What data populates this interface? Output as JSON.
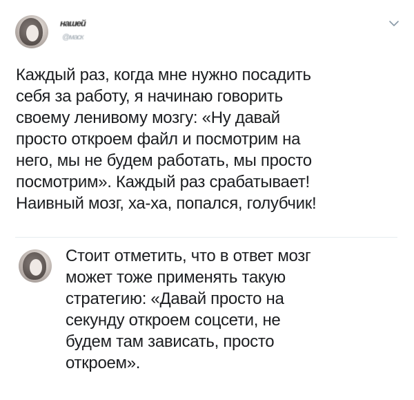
{
  "post": {
    "author": {
      "name": "нашей",
      "handle": "@маск"
    },
    "text": "Каждый раз, когда мне нужно посадить\nсебя за работу, я начинаю говорить\nсвоему ленивому мозгу: «Ну давай\nпросто откроем файл и посмотрим на\nнего, мы не будем работать, мы просто\nпосмотрим». Каждый раз срабатывает!\nНаивный мозг, ха-ха, попался, голубчик!",
    "menu_icon": "chevron-down-icon"
  },
  "reply": {
    "text": "Стоит отметить, что в ответ мозг\nможет тоже применять такую\nстратегию: «Давай просто на\nсекунду откроем соцсети, не\nбудем там зависать, просто\nоткроем»."
  },
  "colors": {
    "text": "#1c1e21",
    "divider": "#e6ecf0",
    "icon": "#8899a6"
  }
}
